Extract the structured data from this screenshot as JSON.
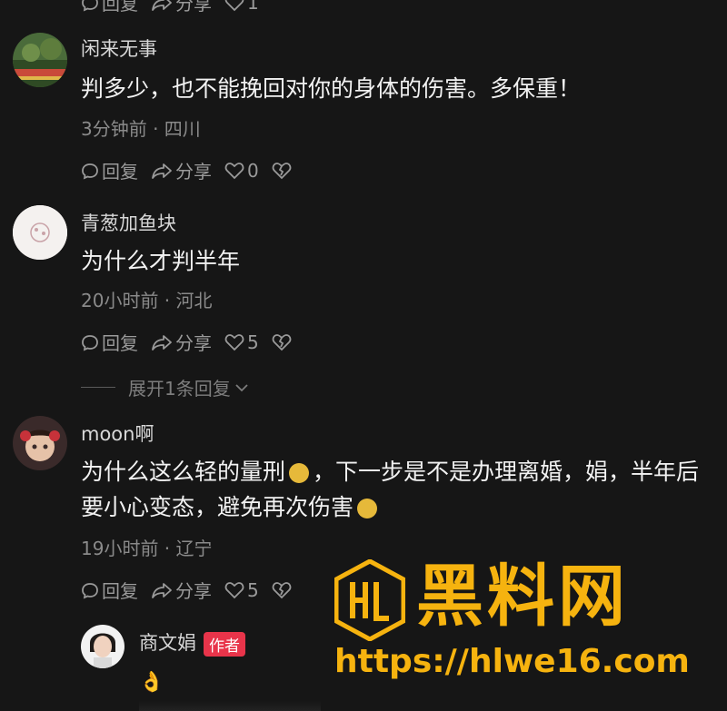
{
  "top_actions": {
    "reply": "回复",
    "share": "分享",
    "likes": "1"
  },
  "comments": [
    {
      "username": "闲来无事",
      "text": "判多少，也不能挽回对你的身体的伤害。多保重！",
      "meta": "3分钟前 · 四川",
      "reply": "回复",
      "share": "分享",
      "likes": "0"
    },
    {
      "username": "青葱加鱼块",
      "text": "为什么才判半年",
      "meta": "20小时前 · 河北",
      "reply": "回复",
      "share": "分享",
      "likes": "5",
      "expand": "展开1条回复"
    },
    {
      "username": "moon啊",
      "text_part1": "为什么这么轻的量刑",
      "text_part2": "，下一步是不是办理离婚，娟，半年后要小心变态，避免再次伤害",
      "meta": "19小时前 · 辽宁",
      "reply": "回复",
      "share": "分享",
      "likes": "5"
    }
  ],
  "reply": {
    "username": "商文娟",
    "badge": "作者",
    "text": "👌"
  },
  "watermark": {
    "title": "黑料网",
    "url": "https://hlwe16.com",
    "color": "#f6b30f"
  }
}
